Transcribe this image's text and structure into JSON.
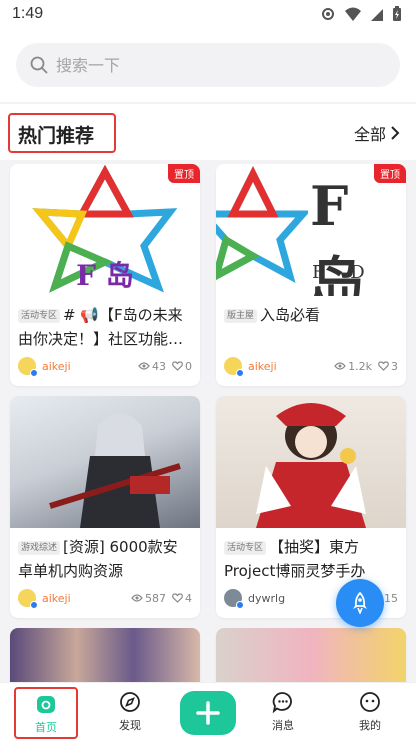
{
  "status_bar": {
    "time": "1:49"
  },
  "search": {
    "placeholder": "搜索一下"
  },
  "section": {
    "title": "热门推荐",
    "see_all": "全部"
  },
  "cards": [
    {
      "pin": "置顶",
      "tag": "活动专区",
      "title": "# 📢【F岛の未来由你决定！】社区功能…",
      "author": "aikeji",
      "views": "43",
      "likes": "0",
      "image_text": "F 岛"
    },
    {
      "pin": "置顶",
      "tag": "版主屋",
      "title": "入岛必看",
      "author": "aikeji",
      "views": "1.2k",
      "likes": "3",
      "image_text": "F岛",
      "image_subtext": "F D A"
    },
    {
      "tag": "游戏综述",
      "title": "[资源] 6000款安卓单机内购资源",
      "author": "aikeji",
      "views": "587",
      "likes": "4"
    },
    {
      "tag": "活动专区",
      "title": "【抽奖】東方Project博丽灵梦手办",
      "author": "dywrlg",
      "views": "",
      "likes": "15"
    }
  ],
  "tabs": [
    {
      "label": "首页"
    },
    {
      "label": "发现"
    },
    {
      "label": "消息"
    },
    {
      "label": "我的"
    }
  ],
  "colors": {
    "accent": "#1ec79a",
    "pin": "#e8252c",
    "fab": "#2a8df5",
    "highlight": "#e53935"
  }
}
